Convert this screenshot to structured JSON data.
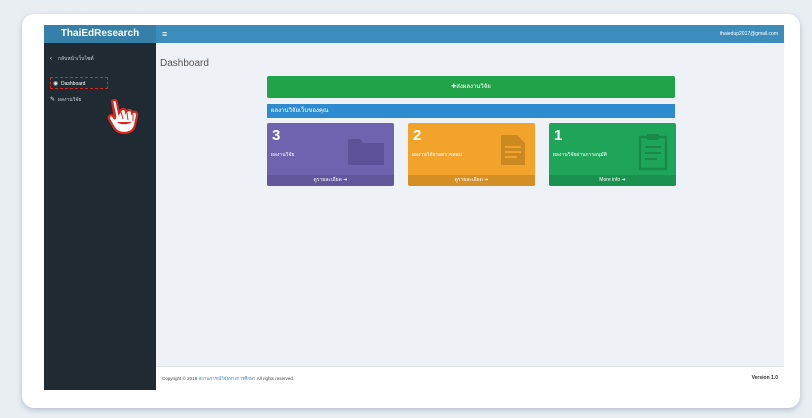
{
  "brand": "ThaiEdResearch",
  "header": {
    "menu_icon": "≡",
    "user_email": "thaiedup2017@gmail.com"
  },
  "sidebar": {
    "items": [
      {
        "icon": "‹",
        "label": "กลับหน้าเว็บไซต์"
      },
      {
        "icon": "◉",
        "label": "Dashboard"
      },
      {
        "icon": "✎",
        "label": "ผลงานวิจัย"
      }
    ]
  },
  "content": {
    "title": "Dashboard",
    "add_button": "✚ส่งผลงานวิจัย",
    "section_title": "ผลงานวิจัยเว็บของคุณ"
  },
  "cards": [
    {
      "count": "3",
      "label": "ผลงานวิจัย",
      "footer": "ดูรายละเอียด ➔",
      "color": "#6f63b0"
    },
    {
      "count": "2",
      "label": "ผลงานวิจัยรอตรวจสอบ",
      "footer": "ดูรายละเอียด ➔",
      "color": "#f2a32b"
    },
    {
      "count": "1",
      "label": "ผลงานวิจัยผ่านการอนุมัติ",
      "footer": "More info ➔",
      "color": "#1fa55a"
    }
  ],
  "footer": {
    "copyright_prefix": "Copyright © 2018",
    "copyright_link": "สถานการณ์วิจัยทางการศึกษา",
    "copyright_suffix": "All rights reserved.",
    "version": "Version 1.0"
  }
}
